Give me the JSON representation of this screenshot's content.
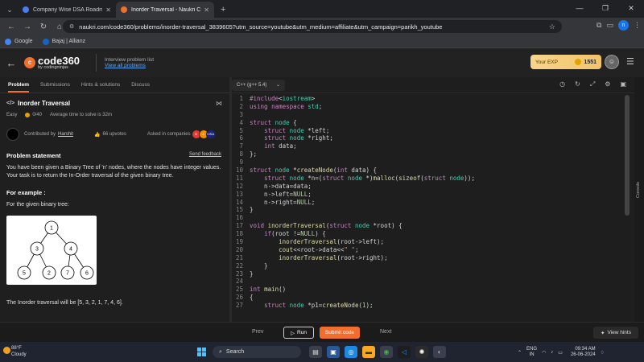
{
  "browser": {
    "tabs": [
      {
        "title": "Company Wise DSA Roadmap",
        "color": "#4a7cf0",
        "active": false
      },
      {
        "title": "Inorder Traversal - Naukri Code",
        "color": "#f16e2e",
        "active": true
      }
    ],
    "url": "naukri.com/code360/problems/inorder-traversal_3839605?utm_source=youtube&utm_medium=affiliate&utm_campaign=parikh_youtube",
    "profile_initial": "n",
    "bookmarks": [
      {
        "label": "Google",
        "color": "#4285f4"
      },
      {
        "label": "Bajaj | Allianz",
        "color": "#1565c0"
      }
    ]
  },
  "header": {
    "logo_word": "code360",
    "logo_sub": "by codingninjas",
    "interview_label": "Interview problem list",
    "view_all": "View all problems",
    "exp_label": "Your EXP",
    "exp_value": "1551"
  },
  "left_tabs": [
    "Problem",
    "Submissions",
    "Hints & solutions",
    "Discuss"
  ],
  "problem": {
    "title": "Inorder Traversal",
    "difficulty": "Easy",
    "score": "0/40",
    "avg_time": "Average time to solve is 32m",
    "contributed_by": "Contributed by",
    "contributor": "Harshit",
    "upvotes": "66 upvotes",
    "asked_in": "Asked in companies",
    "statement_heading": "Problem statement",
    "feedback": "Send feedback",
    "statement": "You have been given a Binary Tree of 'n' nodes, where the nodes have integer values. Your task is to return the In-Order traversal of the given binary tree.",
    "example_heading": "For example :",
    "example_intro": "For the given binary tree:",
    "tree_nodes": [
      "1",
      "3",
      "4",
      "5",
      "2",
      "7",
      "6"
    ],
    "answer": "The Inorder traversal will be [5, 3, 2, 1, 7, 4, 6]."
  },
  "editor": {
    "language": "C++ (g++ 5.4)",
    "lines": [
      "#include<iostream>",
      "using namespace std;",
      "",
      "struct node {",
      "    struct node *left;",
      "    struct node *right;",
      "    int data;",
      "};",
      "",
      "struct node *createNode(int data) {",
      "    struct node *n=(struct node *)malloc(sizeof(struct node));",
      "    n->data=data;",
      "    n->left=NULL;",
      "    n->right=NULL;",
      "}",
      "",
      "void inorderTraversal(struct node *root) {",
      "    if(root !=NULL) {",
      "        inorderTraversal(root->left);",
      "        cout<<root->data<<\" \";",
      "        inorderTraversal(root->right);",
      "    }",
      "}",
      "",
      "int main()",
      "{",
      "    struct node *p1=createNode(1);"
    ],
    "console_label": "Console"
  },
  "footer": {
    "prev": "Prev",
    "run": "Run",
    "submit": "Submit code",
    "next": "Next",
    "hints": "View hints"
  },
  "taskbar": {
    "temp": "88°F",
    "weather": "Cloudy",
    "search": "Search",
    "lang1": "ENG",
    "lang2": "IN",
    "time": "09:34 AM",
    "date": "26-06-2024"
  }
}
